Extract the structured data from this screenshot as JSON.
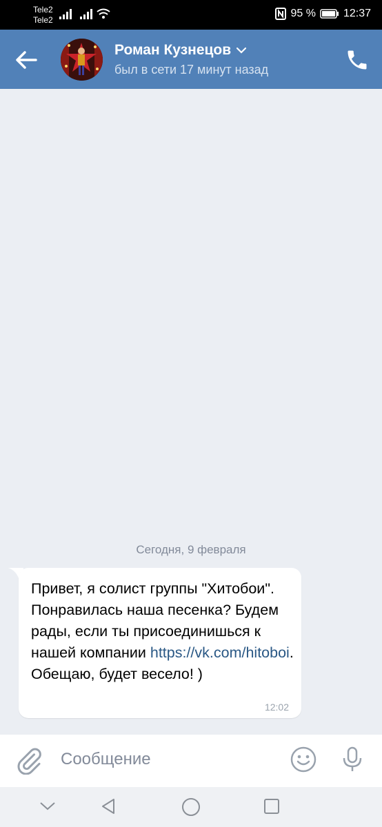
{
  "status": {
    "carrier1": "Tele2",
    "carrier2": "Tele2",
    "battery": "95 %",
    "time": "12:37"
  },
  "header": {
    "name": "Роман Кузнецов",
    "subtitle": "был в сети 17 минут назад"
  },
  "chat": {
    "date_separator": "Сегодня, 9 февраля",
    "messages": [
      {
        "text_before": "Привет, я солист группы \"Хитобои\". Понравилась наша песенка? Будем рады, если ты присоединишься к нашей компании ",
        "link": "https://vk.com/hitoboi",
        "text_after": ". Обещаю, будет весело! )",
        "time": "12:02"
      }
    ]
  },
  "composer": {
    "placeholder": "Сообщение"
  },
  "colors": {
    "header": "#5181b8",
    "background": "#ebeef3",
    "link": "#2a5885"
  }
}
